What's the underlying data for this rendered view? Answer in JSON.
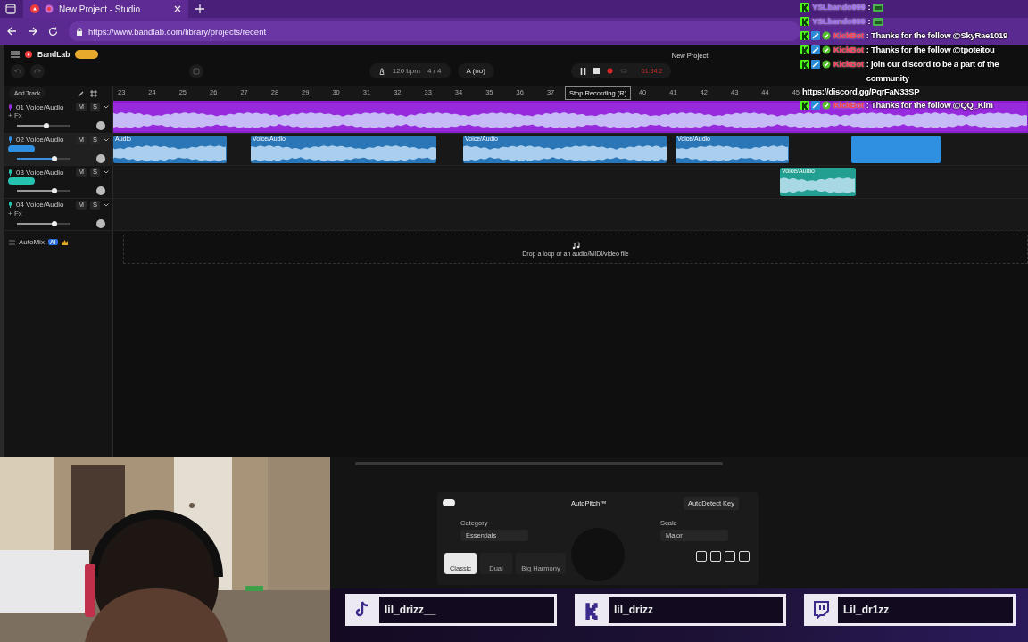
{
  "browser": {
    "tab_title": "New Project - Studio",
    "url": "https://www.bandlab.com/library/projects/recent"
  },
  "studio": {
    "brand": "BandLab",
    "project_title": "New Project",
    "tempo": "120 bpm",
    "time_signature": "4 / 4",
    "key": "A (no)",
    "time": "01:34.2",
    "recording": true,
    "tooltip": "Stop Recording (R)",
    "add_track": "Add Track",
    "ruler": [
      "23",
      "24",
      "25",
      "26",
      "27",
      "28",
      "29",
      "30",
      "31",
      "32",
      "33",
      "34",
      "35",
      "36",
      "37",
      "40",
      "41",
      "42",
      "43",
      "44",
      "45"
    ],
    "tracks": [
      {
        "name": "01 Voice/Audio",
        "kind": "fx",
        "fx": "+ Fx",
        "mute": "M",
        "solo": "S",
        "color": "#9b2de0",
        "selected": false,
        "level": 0.55,
        "clips": [
          {
            "kind": "audio"
          }
        ]
      },
      {
        "name": "02 Voice/Audio",
        "kind": "tag",
        "mute": "M",
        "solo": "S",
        "color": "#2f8fe0",
        "selected": true,
        "level": 0.7,
        "clips": [
          {
            "kind": "audio",
            "label": "Audio"
          },
          {
            "kind": "audio",
            "label": "Voice/Audio"
          },
          {
            "kind": "audio",
            "label": "Voice/Audio"
          },
          {
            "kind": "audio",
            "label": "Voice/Audio"
          },
          {
            "kind": "recording"
          }
        ]
      },
      {
        "name": "03 Voice/Audio",
        "kind": "tag",
        "mute": "M",
        "solo": "S",
        "color": "#25c2b0",
        "selected": false,
        "level": 0.7,
        "clips": [
          {
            "kind": "audio",
            "label": "Voice/Audio"
          }
        ]
      },
      {
        "name": "04 Voice/Audio",
        "kind": "fx",
        "fx": "+ Fx",
        "mute": "M",
        "solo": "S",
        "color": "#25c2b0",
        "selected": false,
        "level": 0.7
      }
    ],
    "automix": {
      "label": "AutoMix",
      "badge": "AI"
    },
    "drop_hint": "Drop a loop or an audio/MIDI/video file"
  },
  "autopitch": {
    "enabled": true,
    "title": "AutoPitch™",
    "autodetect": "AutoDetect Key",
    "category_label": "Category",
    "category": "Essentials",
    "scale_label": "Scale",
    "scale": "Major",
    "presets": [
      {
        "label": "Classic",
        "selected": true
      },
      {
        "label": "Dual",
        "selected": false
      },
      {
        "label": "Big Harmony",
        "selected": false
      }
    ]
  },
  "chat": [
    {
      "kind": "emote",
      "user": "YSLbando999",
      "color": "#a46bff",
      "bot": false,
      "text": ":"
    },
    {
      "kind": "emote",
      "user": "YSLbando999",
      "color": "#a46bff",
      "bot": false,
      "text": ":"
    },
    {
      "kind": "text",
      "user": "KickBot",
      "color": "#ff3a55",
      "bot": true,
      "text": ": Thanks for the follow @SkyRae1019"
    },
    {
      "kind": "text",
      "user": "KickBot",
      "color": "#ff3a55",
      "bot": true,
      "text": ": Thanks for the follow @tpoteitou"
    },
    {
      "kind": "text",
      "user": "KickBot",
      "color": "#ff3a55",
      "bot": true,
      "text": ": join our discord to be a part of the community",
      "link": "https://discord.gg/PqrFaN33SP"
    },
    {
      "kind": "text",
      "user": "KickBot",
      "color": "#ff3a55",
      "bot": true,
      "text": ": Thanks for the follow @QQ_Kim"
    }
  ],
  "socials": [
    {
      "kind": "tiktok",
      "handle": "lil_drizz__"
    },
    {
      "kind": "kick",
      "handle": "lil_drizz"
    },
    {
      "kind": "twitch",
      "handle": "Lil_dr1zz"
    }
  ]
}
